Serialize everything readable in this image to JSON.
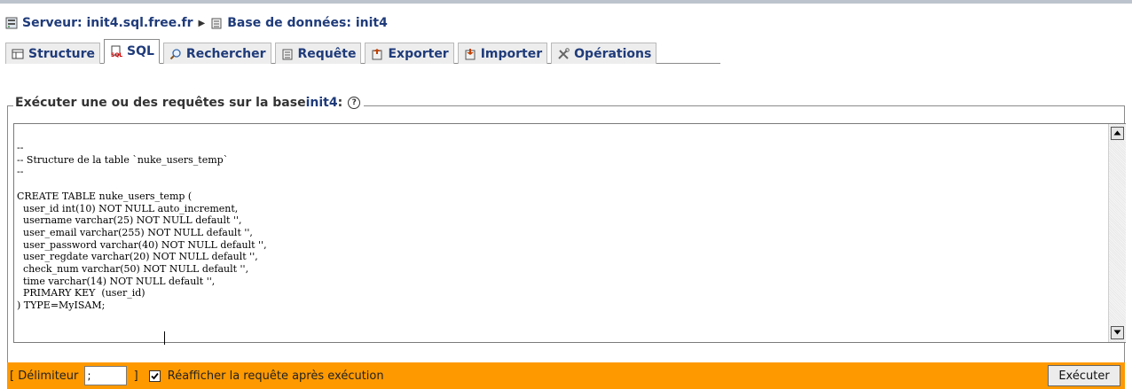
{
  "breadcrumb": {
    "server": "Serveur: init4.sql.free.fr",
    "database": "Base de données: init4",
    "server_icon": "server-icon",
    "database_icon": "database-icon"
  },
  "tabs": [
    {
      "label": "Structure",
      "icon": "structure-icon",
      "active": false
    },
    {
      "label": "SQL",
      "icon": "sql-icon",
      "active": true
    },
    {
      "label": "Rechercher",
      "icon": "search-icon",
      "active": false
    },
    {
      "label": "Requête",
      "icon": "query-icon",
      "active": false
    },
    {
      "label": "Exporter",
      "icon": "export-icon",
      "active": false
    },
    {
      "label": "Importer",
      "icon": "import-icon",
      "active": false
    },
    {
      "label": "Opérations",
      "icon": "operations-icon",
      "active": false
    }
  ],
  "fieldset": {
    "legend_prefix": "Exécuter une ou des requêtes sur la base ",
    "legend_db": "init4",
    "legend_suffix": ":",
    "help_icon": "help-icon"
  },
  "editor": {
    "sql_text": "--\n-- Structure de la table `nuke_users_temp`\n--\n\nCREATE TABLE nuke_users_temp (\n  user_id int(10) NOT NULL auto_increment,\n  username varchar(25) NOT NULL default '',\n  user_email varchar(255) NOT NULL default '',\n  user_password varchar(40) NOT NULL default '',\n  user_regdate varchar(20) NOT NULL default '',\n  check_num varchar(50) NOT NULL default '',\n  time varchar(14) NOT NULL default '',\n  PRIMARY KEY  (user_id)\n) TYPE=MyISAM;"
  },
  "options": {
    "delimiter_open": "[ Délimiteur ",
    "delimiter_value": ";",
    "delimiter_close": " ]",
    "show_query_label": "Réafficher la requête après exécution",
    "show_query_checked": true,
    "execute_label": "Exécuter"
  },
  "colors": {
    "link": "#1f3b7a",
    "bar": "#ff9900"
  }
}
